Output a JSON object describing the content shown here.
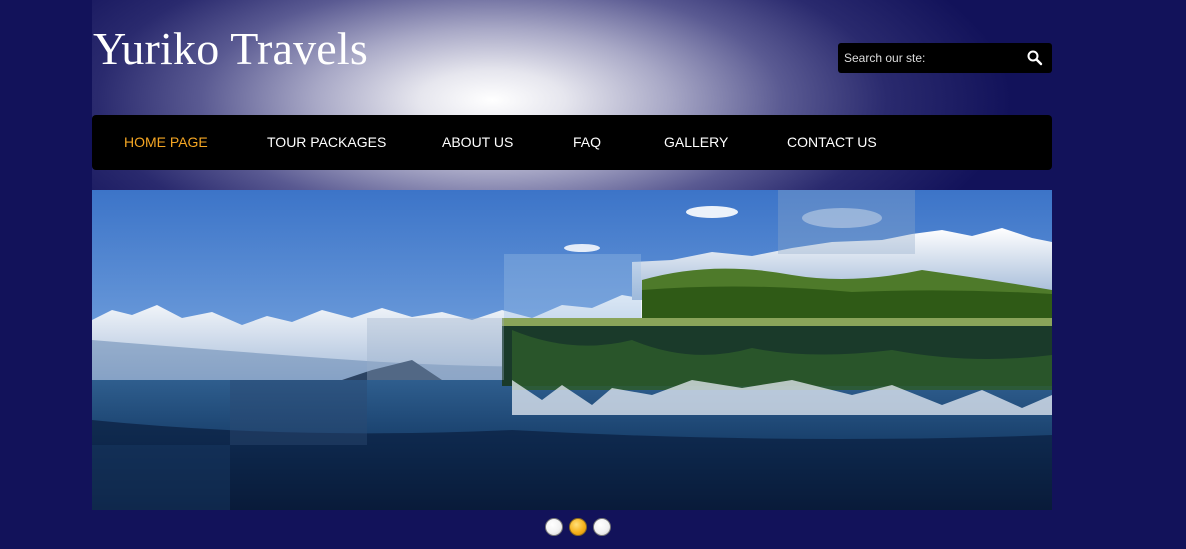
{
  "site": {
    "title": "Yuriko Travels"
  },
  "search": {
    "placeholder": "Search our ste:",
    "value": ""
  },
  "nav": {
    "items": [
      {
        "label": "HOME PAGE",
        "active": true
      },
      {
        "label": "TOUR PACKAGES",
        "active": false
      },
      {
        "label": "ABOUT US",
        "active": false
      },
      {
        "label": "FAQ",
        "active": false
      },
      {
        "label": "GALLERY",
        "active": false
      },
      {
        "label": "CONTACT US",
        "active": false
      }
    ]
  },
  "slider": {
    "image": "mountain-lake-reflection",
    "dots": [
      {
        "active": false
      },
      {
        "active": true
      },
      {
        "active": false
      }
    ]
  },
  "colors": {
    "background": "#12125a",
    "nav_active": "#f5a623",
    "nav_text": "#ffffff",
    "nav_bg": "#000000"
  }
}
